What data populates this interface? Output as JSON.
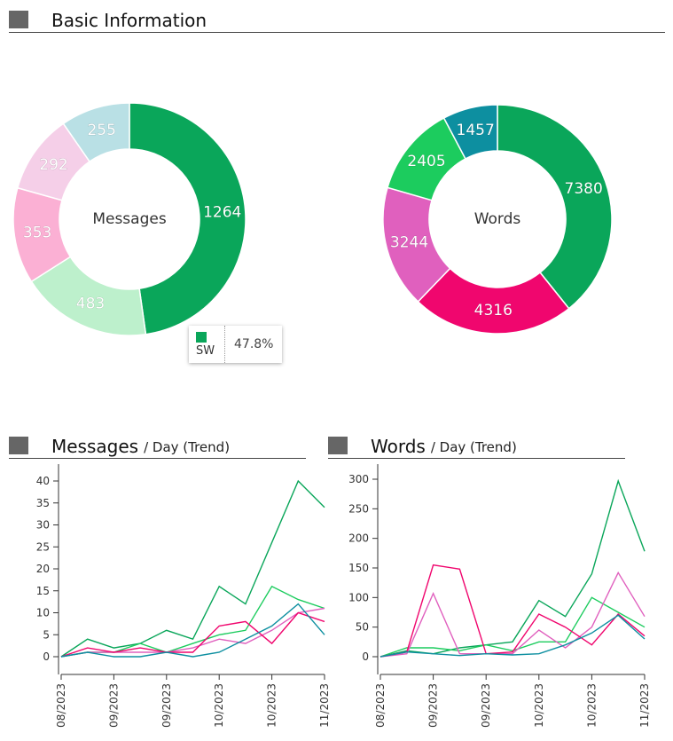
{
  "basic": {
    "title": "Basic Information"
  },
  "messages_section": {
    "title": "Messages",
    "subtitle": "/ Day (Trend)"
  },
  "words_section": {
    "title": "Words",
    "subtitle": "/ Day (Trend)"
  },
  "tooltip": {
    "name": "SW",
    "value": "47.8%",
    "color": "#0aa65a"
  },
  "chart_data": [
    {
      "type": "pie",
      "center_label": "Messages",
      "labels": [
        "SW",
        "",
        "",
        "",
        ""
      ],
      "values": [
        1264,
        483,
        353,
        292,
        255
      ],
      "colors": [
        "#0aa65a",
        "#bdf0cc",
        "#fbb0d4",
        "#f5cfe8",
        "#b9e0e5"
      ]
    },
    {
      "type": "pie",
      "center_label": "Words",
      "values": [
        7380,
        4316,
        3244,
        2405,
        1457
      ],
      "colors": [
        "#0aa65a",
        "#f0066e",
        "#e060be",
        "#1ccc5e",
        "#0d8fa0"
      ]
    },
    {
      "type": "line",
      "x": [
        "08/2023",
        "08/2023",
        "09/2023",
        "09/2023",
        "09/2023",
        "09/2023",
        "10/2023",
        "10/2023",
        "10/2023",
        "10/2023",
        "11/2023"
      ],
      "x_tick_labels": [
        "08/2023",
        "09/2023",
        "09/2023",
        "10/2023",
        "10/2023",
        "11/2023"
      ],
      "ylim": [
        0,
        40
      ],
      "yticks": [
        0,
        5,
        10,
        15,
        20,
        25,
        30,
        35,
        40
      ],
      "series": [
        {
          "color": "#0aa65a",
          "values": [
            0,
            4,
            2,
            3,
            6,
            4,
            16,
            12,
            26,
            40,
            34
          ]
        },
        {
          "color": "#1ccc5e",
          "values": [
            0,
            1,
            1,
            3,
            1,
            3,
            5,
            6,
            16,
            13,
            11
          ]
        },
        {
          "color": "#e060be",
          "values": [
            0,
            1,
            1,
            1,
            1,
            2,
            4,
            3,
            6,
            10,
            11
          ]
        },
        {
          "color": "#f0066e",
          "values": [
            0,
            2,
            1,
            2,
            1,
            1,
            7,
            8,
            3,
            10,
            8
          ]
        },
        {
          "color": "#0d8fa0",
          "values": [
            0,
            1,
            0,
            0,
            1,
            0,
            1,
            4,
            7,
            12,
            5
          ]
        }
      ]
    },
    {
      "type": "line",
      "x": [
        "08/2023",
        "08/2023",
        "09/2023",
        "09/2023",
        "09/2023",
        "09/2023",
        "10/2023",
        "10/2023",
        "10/2023",
        "10/2023",
        "11/2023"
      ],
      "x_tick_labels": [
        "08/2023",
        "09/2023",
        "09/2023",
        "10/2023",
        "10/2023",
        "11/2023"
      ],
      "ylim": [
        0,
        300
      ],
      "yticks": [
        0,
        50,
        100,
        150,
        200,
        250,
        300
      ],
      "series": [
        {
          "color": "#0aa65a",
          "values": [
            0,
            10,
            5,
            15,
            20,
            25,
            95,
            68,
            140,
            297,
            178
          ]
        },
        {
          "color": "#1ccc5e",
          "values": [
            0,
            15,
            15,
            10,
            20,
            10,
            25,
            25,
            100,
            75,
            50
          ]
        },
        {
          "color": "#e060be",
          "values": [
            0,
            5,
            107,
            5,
            5,
            5,
            45,
            15,
            50,
            142,
            68
          ]
        },
        {
          "color": "#f0066e",
          "values": [
            0,
            8,
            155,
            148,
            5,
            8,
            72,
            50,
            20,
            72,
            35
          ]
        },
        {
          "color": "#0d8fa0",
          "values": [
            0,
            8,
            5,
            2,
            5,
            3,
            5,
            20,
            40,
            70,
            30
          ]
        }
      ]
    }
  ]
}
